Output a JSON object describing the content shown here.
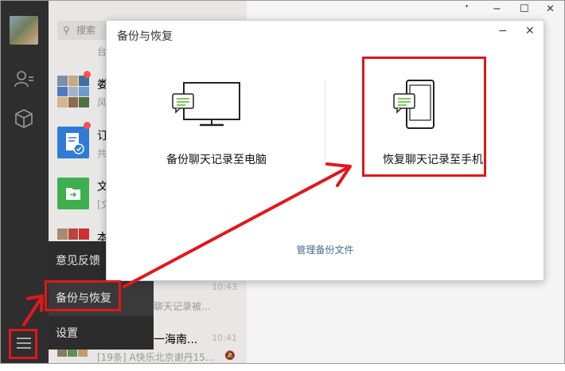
{
  "window": {
    "pin": "ᐩ",
    "minimize": "−",
    "maximize": "☐",
    "close": "✕"
  },
  "search": {
    "placeholder": "搜索",
    "icon": "search-icon"
  },
  "sidebar": {
    "icons": [
      "contacts-icon",
      "mini-program-icon",
      "menu-icon"
    ]
  },
  "chats": [
    {
      "title": "",
      "snippet": "台"
    },
    {
      "title": "娄",
      "snippet": "风"
    },
    {
      "title": "订",
      "snippet": "共"
    },
    {
      "title": "文",
      "snippet": "[文"
    },
    {
      "title": "本",
      "snippet": ""
    },
    {
      "title": "",
      "time": "10:43",
      "snippet": "聊天记录被..."
    },
    {
      "title": "一海南...",
      "time": "10:41",
      "snippet": "[19条] A快乐北京谢丹15..."
    }
  ],
  "menu": {
    "feedback": "意见反馈",
    "backup": "备份与恢复",
    "settings": "设置"
  },
  "dialog": {
    "title": "备份与恢复",
    "minimize": "−",
    "close": "✕",
    "backup_to_pc": "备份聊天记录至电脑",
    "restore_to_phone": "恢复聊天记录至手机",
    "manage_files": "管理备份文件"
  },
  "colors": {
    "annotation": "#e0181c",
    "sidebar": "#2e2e2e",
    "link": "#456a94",
    "chat_bubble": "#5dbb3b"
  }
}
